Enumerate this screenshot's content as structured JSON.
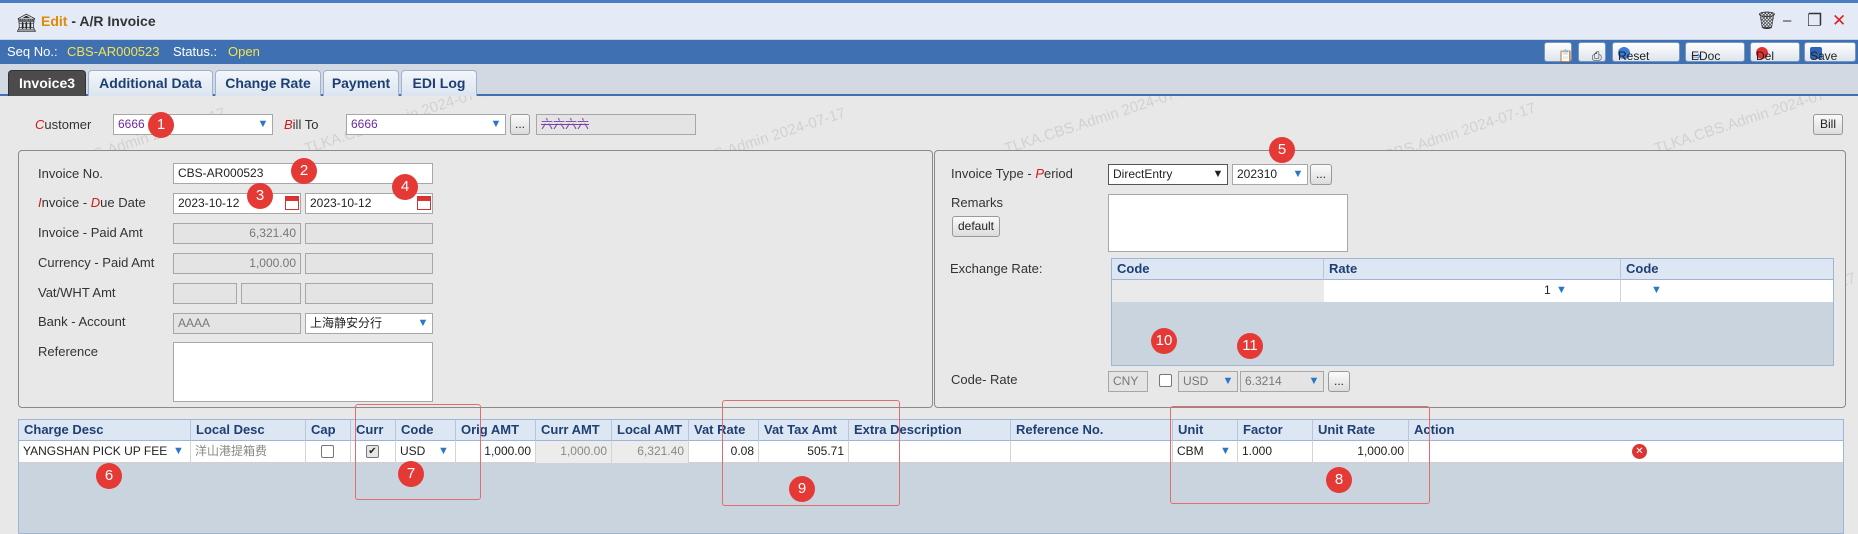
{
  "window": {
    "edit_label": "Edit",
    "title_rest": " - A/R Invoice"
  },
  "status": {
    "seq_label": "Seq No.:",
    "seq_value": "CBS-AR000523",
    "status_label": "Status.:",
    "status_value": "Open"
  },
  "toolbar": {
    "reset": "Reset",
    "edoc": "EDoc",
    "del": "Del",
    "save": "Save"
  },
  "tabs": [
    "Invoice3",
    "Additional Data",
    "Change Rate",
    "Payment",
    "EDI Log"
  ],
  "header": {
    "customer_label_first": "C",
    "customer_label_rest": "ustomer",
    "customer_value": "6666",
    "billto_label_first": "B",
    "billto_label_rest": "ill To",
    "billto_value": "6666",
    "billto_name": "六六六六",
    "bill_button": "Bill"
  },
  "left": {
    "invoice_no_label": "Invoice No.",
    "invoice_no_value": "CBS-AR000523",
    "inv_date_label_a": "I",
    "inv_date_label_b": "nvoice - ",
    "inv_date_label_c": "D",
    "inv_date_label_d": "ue Date",
    "invoice_date": "2023-10-12",
    "due_date": "2023-10-12",
    "paid_amt_label": "Invoice - Paid Amt",
    "invoice_amt": "6,321.40",
    "currency_paid_label": "Currency - Paid Amt",
    "currency_amt": "1,000.00",
    "vat_label": "Vat/WHT Amt",
    "bank_label": "Bank - Account",
    "bank_value": "AAAA",
    "account_value": "上海静安分行",
    "reference_label": "Reference"
  },
  "right": {
    "invoice_type_label_a": "Invoice Type - ",
    "invoice_type_label_b": "P",
    "invoice_type_label_c": "eriod",
    "invoice_type_value": "DirectEntry",
    "period_value": "202310",
    "remarks_label": "Remarks",
    "default_button": "default",
    "exchange_label": "Exchange Rate:",
    "exchange_headers": [
      "Code",
      "Rate",
      "Code"
    ],
    "exchange_rate_value": "1",
    "code_rate_label": "Code- Rate",
    "code_cny": "CNY",
    "code_usd": "USD",
    "rate_value": "6.3214"
  },
  "charges": {
    "headers": [
      "Charge Desc",
      "Local Desc",
      "Cap",
      "Curr",
      "Code",
      "Orig AMT",
      "Curr AMT",
      "Local AMT",
      "Vat Rate",
      "Vat Tax Amt",
      "Extra Description",
      "Reference No.",
      "Unit",
      "Factor",
      "Unit Rate",
      "Action"
    ],
    "row": {
      "charge_desc": "YANGSHAN PICK UP FEE",
      "local_desc": "洋山港提箱费",
      "code": "USD",
      "orig_amt": "1,000.00",
      "curr_amt": "1,000.00",
      "local_amt": "6,321.40",
      "vat_rate": "0.08",
      "vat_tax_amt": "505.71",
      "unit": "CBM",
      "factor": "1.000",
      "unit_rate": "1,000.00"
    }
  },
  "annotations": [
    "1",
    "2",
    "3",
    "4",
    "5",
    "6",
    "7",
    "8",
    "9",
    "10",
    "11"
  ],
  "watermark": "TLKA.CBS.Admin 2024-07-17",
  "colors": {
    "accent": "#3f71b2",
    "badge": "#e53935",
    "status_yellow": "#f3e24f"
  }
}
